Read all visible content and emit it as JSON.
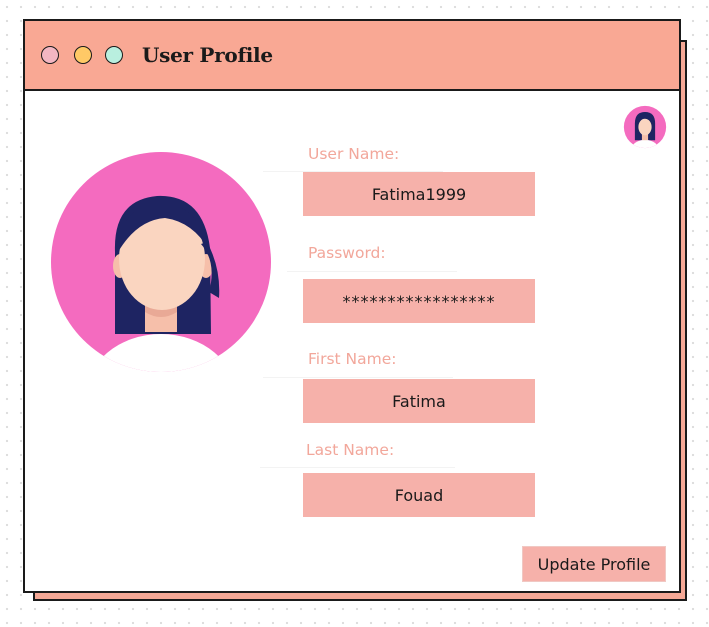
{
  "window": {
    "title": "User Profile",
    "controls": [
      "close",
      "minimize",
      "maximize"
    ]
  },
  "avatar": {
    "large_icon": "female-user-avatar-icon",
    "small_icon": "female-user-avatar-icon"
  },
  "form": {
    "fields": [
      {
        "label": "User Name:",
        "value": "Fatima1999"
      },
      {
        "label": "Password:",
        "value": "*****************"
      },
      {
        "label": "First Name:",
        "value": "Fatima"
      },
      {
        "label": "Last Name:",
        "value": "Fouad"
      }
    ],
    "submit_label": "Update Profile"
  },
  "colors": {
    "titlebar": "#f9a894",
    "field_bg": "#f6b1aa",
    "label_text": "#f2a79b",
    "avatar_circle": "#f46bbf",
    "hair": "#1e2462",
    "skin": "#fad5c0"
  }
}
